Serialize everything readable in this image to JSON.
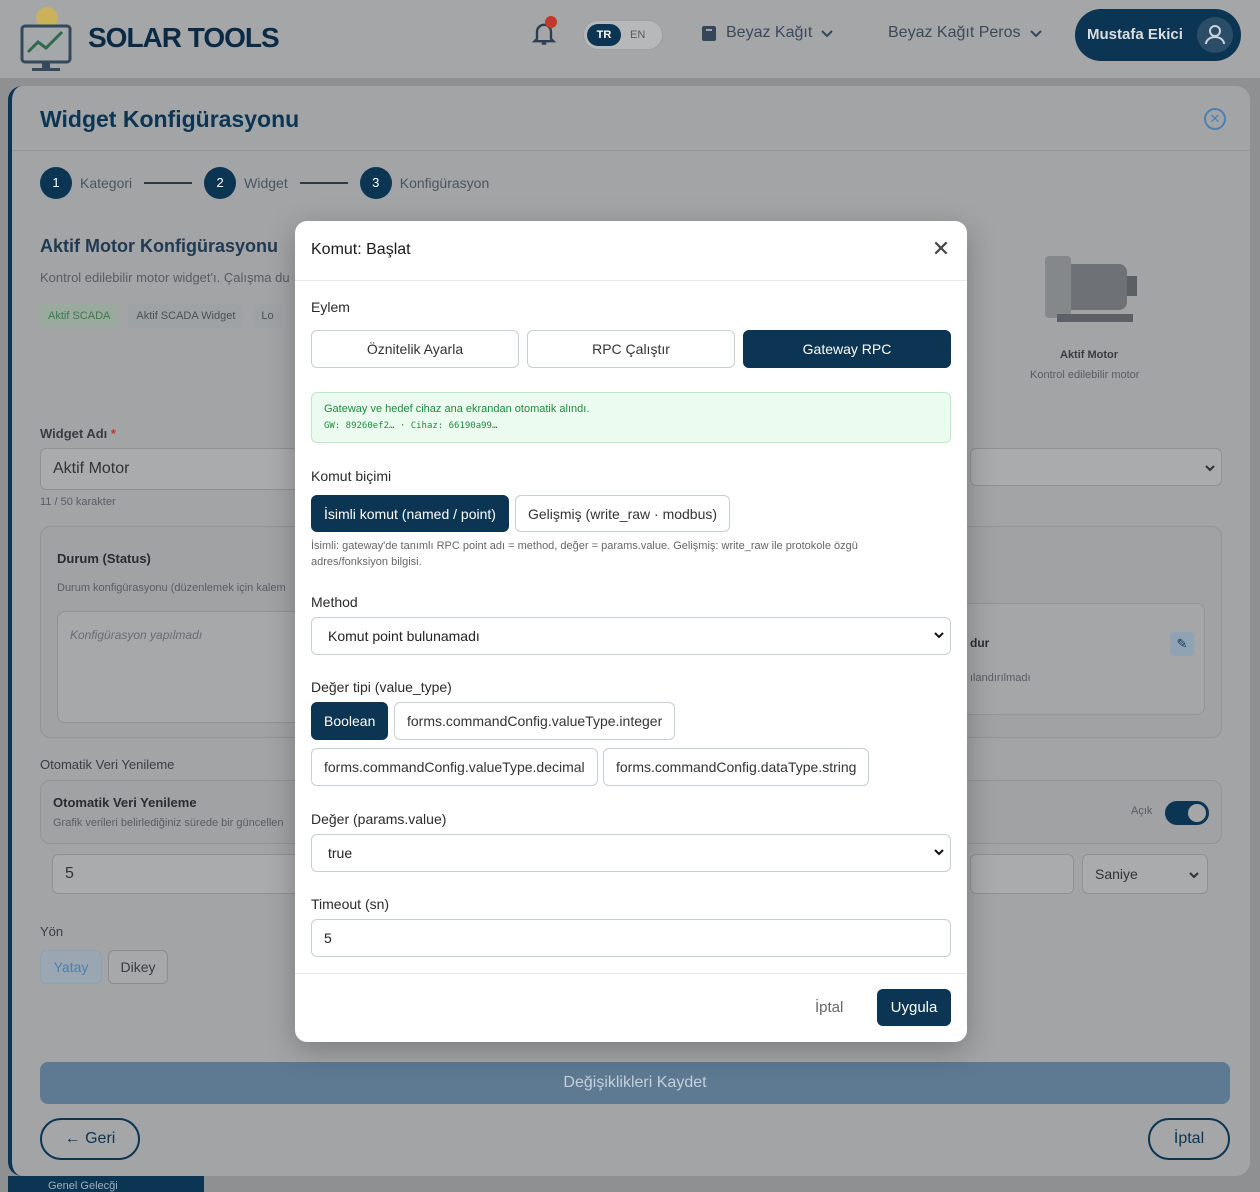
{
  "header": {
    "brand": "SOLAR TOOLS",
    "lang_tr": "TR",
    "lang_en": "EN",
    "nav1": "Beyaz Kağıt",
    "nav2": "Beyaz Kağıt Peros",
    "user": "Mustafa Ekici"
  },
  "panel": {
    "title": "Widget Konfigürasyonu",
    "steps": [
      {
        "num": "1",
        "label": "Kategori"
      },
      {
        "num": "2",
        "label": "Widget"
      },
      {
        "num": "3",
        "label": "Konfigürasyon"
      }
    ],
    "section_title": "Aktif Motor Konfigürasyonu",
    "section_desc": "Kontrol edilebilir motor widget'ı. Çalışma du",
    "tags": [
      "Aktif SCADA",
      "Aktif SCADA Widget",
      "Lo"
    ],
    "preview_title": "Aktif Motor",
    "preview_desc": "Kontrol edilebilir motor",
    "widget_name_label": "Widget Adı",
    "widget_name_value": "Aktif Motor",
    "char_count": "11 / 50 karakter",
    "status_title": "Durum (Status)",
    "status_desc": "Durum konfigürasyonu (düzenlemek için kalem",
    "status_empty": "Konfigürasyon yapılmadı",
    "right_card_title": "dur",
    "right_card_desc": "ılandırılmadı",
    "refresh_label": "Otomatik Veri Yenileme",
    "refresh_title": "Otomatik Veri Yenileme",
    "refresh_desc": "Grafik verileri belirlediğiniz sürede bir güncellen",
    "refresh_toggle": "Açık",
    "refresh_value": "5",
    "refresh_unit": "Saniye",
    "direction_label": "Yön",
    "dir_h": "Yatay",
    "dir_v": "Dikey",
    "save": "Değişiklikleri Kaydet",
    "back": "← Geri",
    "cancel": "İptal",
    "bottom_peek": "Genel Gelecği"
  },
  "modal": {
    "title": "Komut: Başlat",
    "action_label": "Eylem",
    "actions": [
      "Öznitelik Ayarla",
      "RPC Çalıştır",
      "Gateway RPC"
    ],
    "active_action": 2,
    "alert_text": "Gateway ve hedef cihaz ana ekrandan otomatik alındı.",
    "alert_code": "GW: 89260ef2… · Cihaz: 66190a99…",
    "format_label": "Komut biçimi",
    "formats": [
      "İsimli komut (named / point)",
      "Gelişmiş (write_raw · modbus)"
    ],
    "format_help": "İsimli: gateway'de tanımlı RPC point adı = method, değer = params.value. Gelişmiş: write_raw ile protokole özgü adres/fonksiyon bilgisi.",
    "method_label": "Method",
    "method_value": "Komut point bulunamadı",
    "value_type_label": "Değer tipi (value_type)",
    "value_types": [
      "Boolean",
      "forms.commandConfig.valueType.integer",
      "forms.commandConfig.valueType.decimal",
      "forms.commandConfig.dataType.string"
    ],
    "value_label": "Değer (params.value)",
    "value_value": "true",
    "timeout_label": "Timeout (sn)",
    "timeout_value": "5",
    "cancel": "İptal",
    "apply": "Uygula"
  },
  "colors": {
    "primary": "#0b3552",
    "success": "#1f8a3f",
    "overlay": "#8f9092"
  }
}
